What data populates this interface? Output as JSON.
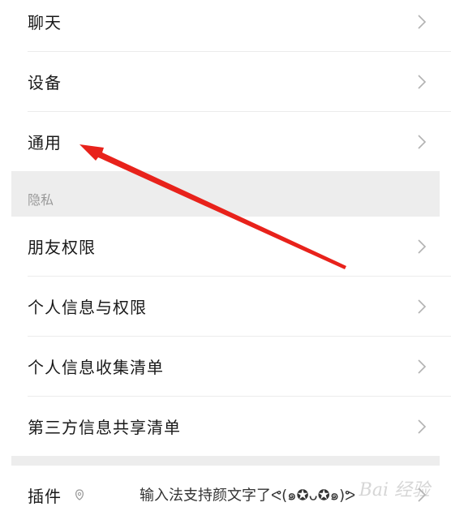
{
  "settings": {
    "rows_top": [
      {
        "label": "聊天"
      },
      {
        "label": "设备"
      },
      {
        "label": "通用"
      }
    ],
    "privacy_section_title": "隐私",
    "rows_privacy": [
      {
        "label": "朋友权限"
      },
      {
        "label": "个人信息与权限"
      },
      {
        "label": "个人信息收集清单"
      },
      {
        "label": "第三方信息共享清单"
      }
    ],
    "plugin": {
      "label": "插件",
      "icon": "plugin-icon",
      "status": "输入法支持颜文字了ᕙ(๑✪ᴗ✪๑)ᕗ"
    }
  },
  "annotation": {
    "type": "red-arrow",
    "color": "#e8221b",
    "target": "通用"
  },
  "watermark": "Bai 经验",
  "colors": {
    "section_bg": "#ededed",
    "text": "#191919",
    "chevron": "#b2b2b2"
  }
}
